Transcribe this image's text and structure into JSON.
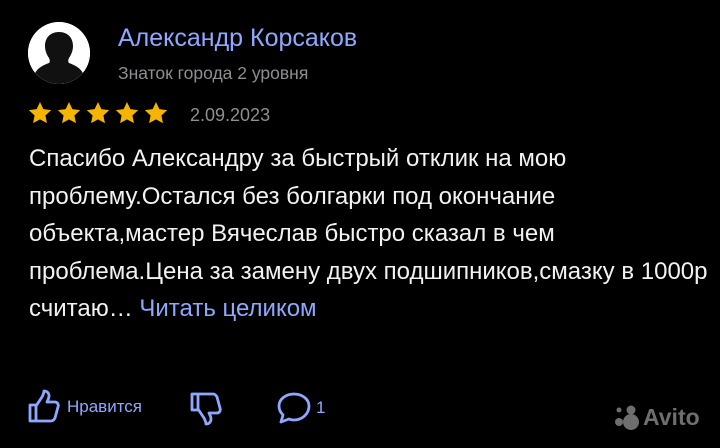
{
  "review": {
    "author": {
      "name": "Александр Корсаков",
      "level": "Знаток города 2 уровня",
      "avatar_icon": "person-silhouette-icon"
    },
    "rating": 5,
    "rating_max": 5,
    "date": "2.09.2023",
    "text": "Спасибо Александру за быстрый отклик на мою проблему.Остался без болгарки под окончание объекта,мастер Вячеслав быстро сказал в чем проблема.Цена за замену двух подшипников,смазку в 1000р считаю…",
    "read_more": "Читать целиком"
  },
  "actions": {
    "like_label": "Нравится",
    "like_icon": "thumbs-up-icon",
    "dislike_icon": "thumbs-down-icon",
    "comment_icon": "comment-bubble-icon",
    "comment_count": "1"
  },
  "watermark": {
    "text": "Avito",
    "icon": "avito-logo-icon"
  },
  "colors": {
    "background": "#000000",
    "accent": "#8fa8ff",
    "star": "#f5b400",
    "muted": "#8e8e93",
    "text": "#f2f2f2"
  }
}
